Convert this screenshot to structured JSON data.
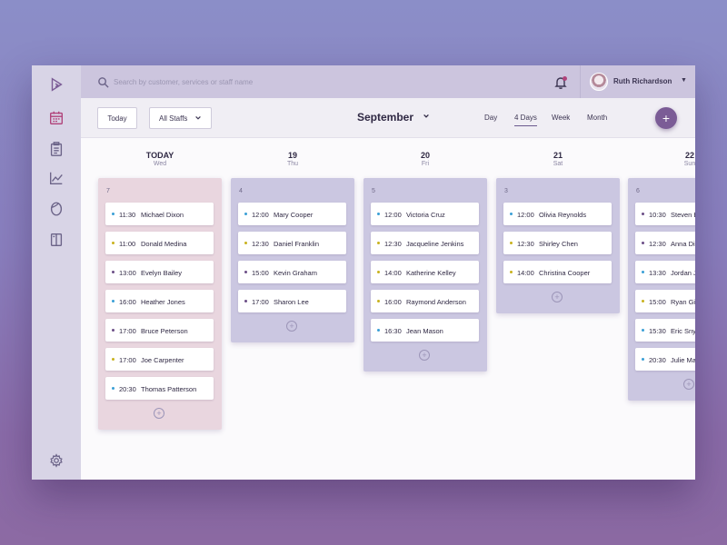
{
  "search": {
    "placeholder": "Search by customer, services or staff name"
  },
  "user": {
    "name": "Ruth Richardson"
  },
  "toolbar": {
    "today_label": "Today",
    "staff_label": "All Staffs",
    "month_label": "September",
    "views": [
      "Day",
      "4 Days",
      "Week",
      "Month"
    ],
    "active_view": "4 Days",
    "add_label": "+"
  },
  "colors": {
    "today_column": "#e9d6df",
    "column": "#cbc7e1",
    "accent": "#7b5c96",
    "dot_blue": "#3a9fd6",
    "dot_yellow": "#c9b21d",
    "dot_purple": "#6b4e86"
  },
  "days": [
    {
      "num": "TODAY",
      "name": "Wed",
      "count": "7",
      "is_today": true,
      "appointments": [
        {
          "time": "11:30",
          "name": "Michael Dixon",
          "dot": "blue"
        },
        {
          "time": "11:00",
          "name": "Donald Medina",
          "dot": "yellow"
        },
        {
          "time": "13:00",
          "name": "Evelyn Bailey",
          "dot": "purple"
        },
        {
          "time": "16:00",
          "name": "Heather Jones",
          "dot": "blue"
        },
        {
          "time": "17:00",
          "name": "Bruce Peterson",
          "dot": "purple"
        },
        {
          "time": "17:00",
          "name": "Joe Carpenter",
          "dot": "yellow"
        },
        {
          "time": "20:30",
          "name": "Thomas Patterson",
          "dot": "blue"
        }
      ]
    },
    {
      "num": "19",
      "name": "Thu",
      "count": "4",
      "is_today": false,
      "appointments": [
        {
          "time": "12:00",
          "name": "Mary Cooper",
          "dot": "blue"
        },
        {
          "time": "12:30",
          "name": "Daniel Franklin",
          "dot": "yellow"
        },
        {
          "time": "15:00",
          "name": "Kevin Graham",
          "dot": "purple"
        },
        {
          "time": "17:00",
          "name": "Sharon Lee",
          "dot": "purple"
        }
      ]
    },
    {
      "num": "20",
      "name": "Fri",
      "count": "5",
      "is_today": false,
      "appointments": [
        {
          "time": "12:00",
          "name": "Victoria Cruz",
          "dot": "blue"
        },
        {
          "time": "12:30",
          "name": "Jacqueline Jenkins",
          "dot": "yellow"
        },
        {
          "time": "14:00",
          "name": "Katherine Kelley",
          "dot": "yellow"
        },
        {
          "time": "16:00",
          "name": "Raymond Anderson",
          "dot": "yellow"
        },
        {
          "time": "16:30",
          "name": "Jean Mason",
          "dot": "blue"
        }
      ]
    },
    {
      "num": "21",
      "name": "Sat",
      "count": "3",
      "is_today": false,
      "appointments": [
        {
          "time": "12:00",
          "name": "Olivia Reynolds",
          "dot": "blue"
        },
        {
          "time": "12:30",
          "name": "Shirley Chen",
          "dot": "yellow"
        },
        {
          "time": "14:00",
          "name": "Christina Cooper",
          "dot": "yellow"
        }
      ]
    },
    {
      "num": "22",
      "name": "Sun",
      "count": "6",
      "is_today": false,
      "appointments": [
        {
          "time": "10:30",
          "name": "Steven Burke",
          "dot": "purple"
        },
        {
          "time": "12:30",
          "name": "Anna Diaz",
          "dot": "purple"
        },
        {
          "time": "13:30",
          "name": "Jordan Jackson",
          "dot": "blue"
        },
        {
          "time": "15:00",
          "name": "Ryan Gibson",
          "dot": "yellow"
        },
        {
          "time": "15:30",
          "name": "Eric Snyder",
          "dot": "blue"
        },
        {
          "time": "20:30",
          "name": "Julie Martin",
          "dot": "blue"
        }
      ]
    }
  ]
}
